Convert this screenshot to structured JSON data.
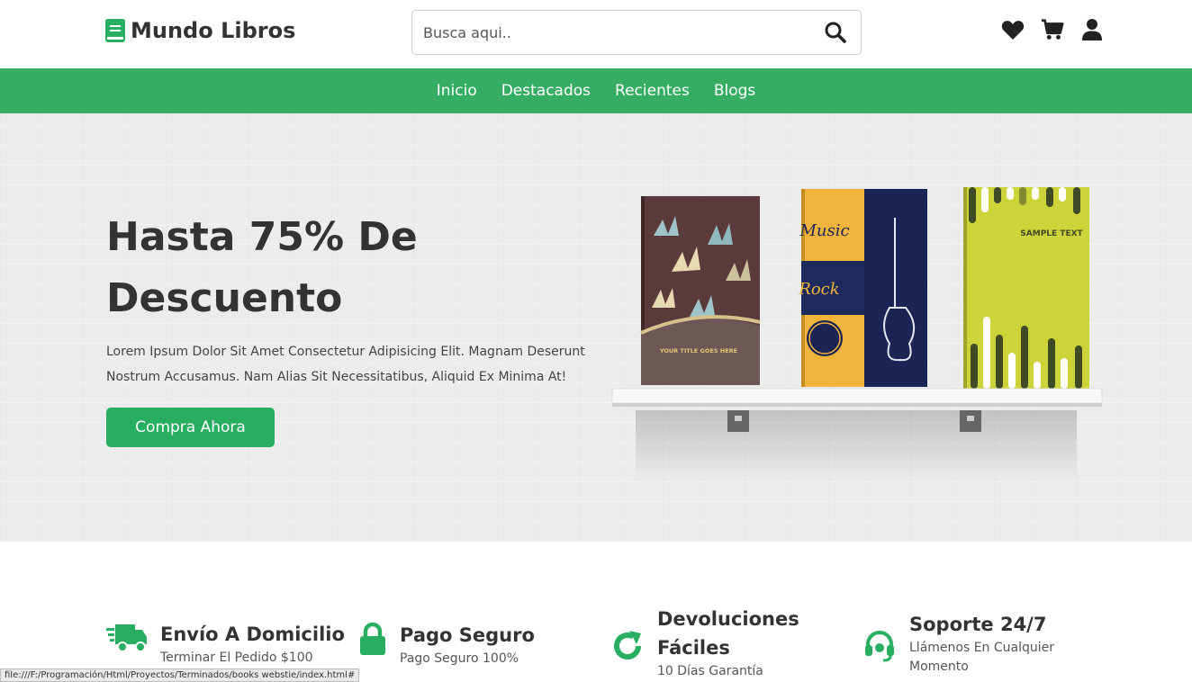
{
  "header": {
    "logo_text": "Mundo Libros",
    "search_placeholder": "Busca aqui..",
    "icons": [
      "heart-icon",
      "cart-icon",
      "user-icon"
    ]
  },
  "nav": {
    "items": [
      "Inicio",
      "Destacados",
      "Recientes",
      "Blogs"
    ]
  },
  "hero": {
    "title": "Hasta 75% De Descuento",
    "description": "Lorem Ipsum Dolor Sit Amet Consectetur Adipisicing Elit. Magnam Deserunt Nostrum Accusamus. Nam Alias Sit Necessitatibus, Aliquid Ex Minima At!",
    "button": "Compra Ahora",
    "books": {
      "book1_text": "YOUR TITLE GOES HERE",
      "book2_text_music": "Music",
      "book2_text_rock": "Rock",
      "book3_text": "SAMPLE TEXT"
    }
  },
  "features": [
    {
      "title": "Envío A Domicilio",
      "subtitle": "Terminar El Pedido $100",
      "icon": "truck-icon"
    },
    {
      "title": "Pago Seguro",
      "subtitle": "Pago Seguro 100%",
      "icon": "lock-icon"
    },
    {
      "title": "Devoluciones Fáciles",
      "subtitle": "10 Días Garantía",
      "icon": "redo-icon"
    },
    {
      "title": "Soporte 24/7",
      "subtitle": "Llámenos En Cualquier Momento",
      "icon": "headset-icon"
    }
  ],
  "statusbar": {
    "url": "file:///F:/Programación/Html/Proyectos/Terminados/books webstie/index.html#"
  },
  "colors": {
    "brand_green": "#27ae60",
    "nav_green": "#35ae64",
    "text_dark": "#333333"
  }
}
